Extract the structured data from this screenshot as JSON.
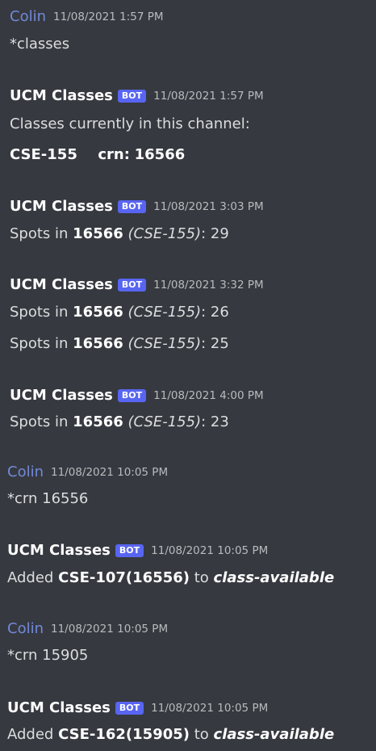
{
  "messages": [
    {
      "author": "Colin",
      "timestamp": "11/08/2021 1:57 PM",
      "lines": [
        {
          "text": "*classes"
        }
      ]
    },
    {
      "author": "UCM Classes",
      "bot_tag": "BOT",
      "timestamp": "11/08/2021 1:57 PM",
      "lines": [
        {
          "text": "Classes currently in this channel:"
        },
        {
          "course": "CSE-155",
          "crn_label": "crn:",
          "crn": "16566"
        }
      ]
    },
    {
      "author": "UCM Classes",
      "bot_tag": "BOT",
      "timestamp": "11/08/2021 3:03 PM",
      "lines": [
        {
          "prefix": "Spots in ",
          "crn": "16566",
          "course": "(CSE-155)",
          "count": ": 29"
        }
      ]
    },
    {
      "author": "UCM Classes",
      "bot_tag": "BOT",
      "timestamp": "11/08/2021 3:32 PM",
      "lines": [
        {
          "prefix": "Spots in ",
          "crn": "16566",
          "course": "(CSE-155)",
          "count": ": 26"
        },
        {
          "prefix": "Spots in ",
          "crn": "16566",
          "course": "(CSE-155)",
          "count": ": 25"
        }
      ]
    },
    {
      "author": "UCM Classes",
      "bot_tag": "BOT",
      "timestamp": "11/08/2021 4:00 PM",
      "lines": [
        {
          "prefix": "Spots in ",
          "crn": "16566",
          "course": "(CSE-155)",
          "count": ": 23"
        }
      ]
    },
    {
      "author": "Colin",
      "timestamp": "11/08/2021 10:05 PM",
      "lines": [
        {
          "text": "*crn 16556"
        }
      ]
    },
    {
      "author": "UCM Classes",
      "bot_tag": "BOT",
      "timestamp": "11/08/2021 10:05 PM",
      "lines": [
        {
          "prefix": "Added ",
          "course_crn": "CSE-107(16556)",
          "middle": " to ",
          "channel": "class-available"
        }
      ]
    },
    {
      "author": "Colin",
      "timestamp": "11/08/2021 10:05 PM",
      "lines": [
        {
          "text": "*crn 15905"
        }
      ]
    },
    {
      "author": "UCM Classes",
      "bot_tag": "BOT",
      "timestamp": "11/08/2021 10:05 PM",
      "lines": [
        {
          "prefix": "Added ",
          "course_crn": "CSE-162(15905)",
          "middle": " to ",
          "channel": "class-available"
        }
      ]
    }
  ]
}
